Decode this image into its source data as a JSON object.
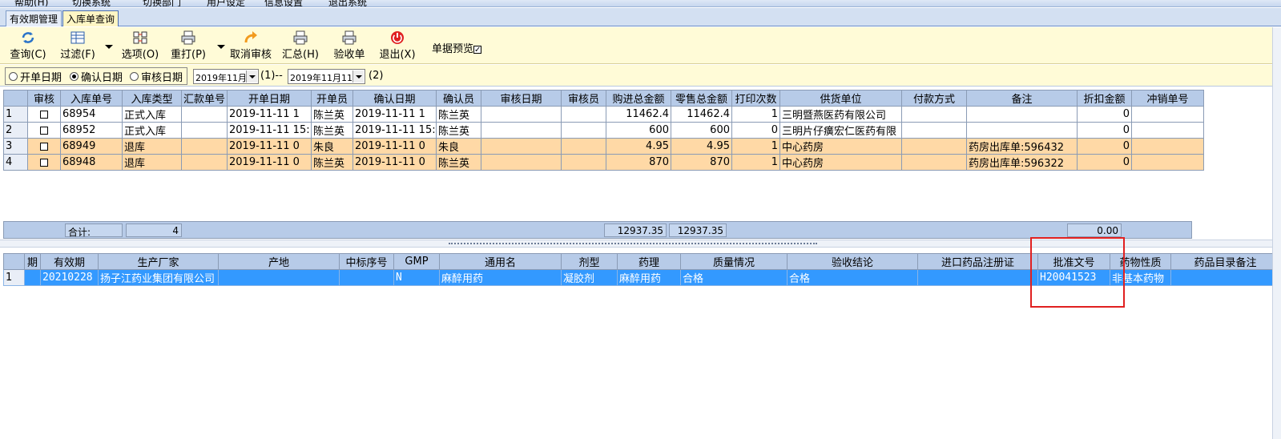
{
  "top_menu": [
    "帮助(H)",
    "切换系统",
    "切换部门",
    "用户设定",
    "信息设置",
    "退出系统"
  ],
  "tabs": [
    {
      "label": "有效期管理",
      "active": false
    },
    {
      "label": "入库单查询",
      "active": true
    }
  ],
  "toolbar": {
    "query": "查询(C)",
    "filter": "过滤(F)",
    "options": "选项(O)",
    "reprint": "重打(P)",
    "cancel_audit": "取消审核",
    "summary": "汇总(H)",
    "inspect": "验收单",
    "exit": "退出(X)",
    "preview_label": "单据预览",
    "preview_checked": true
  },
  "date_filter": {
    "options": [
      "开单日期",
      "确认日期",
      "审核日期"
    ],
    "selected": "确认日期",
    "start": "2019年11月",
    "start_suffix": "(1)--",
    "end": "2019年11月11日",
    "end_suffix": "(2)"
  },
  "upper_grid": {
    "columns": [
      "",
      "审核",
      "入库单号",
      "入库类型",
      "汇款单号",
      "开单日期",
      "开单员",
      "确认日期",
      "确认员",
      "审核日期",
      "审核员",
      "购进总金额",
      "零售总金额",
      "打印次数",
      "供货单位",
      "付款方式",
      "备注",
      "折扣金额",
      "冲销单号"
    ],
    "rows": [
      {
        "idx": "1",
        "no": "68954",
        "type": "正式入库",
        "remit": "",
        "open_date": "2019-11-11 1",
        "opener": "陈兰英",
        "confirm_date": "2019-11-11 1",
        "confirmer": "陈兰英",
        "audit_date": "",
        "auditor": "",
        "purchase": "11462.4",
        "retail": "11462.4",
        "prints": "1",
        "supplier": "三明暨燕医药有限公司",
        "payment": "",
        "note": "",
        "discount": "0",
        "reverse": "",
        "highlight": false
      },
      {
        "idx": "2",
        "no": "68952",
        "type": "正式入库",
        "remit": "",
        "open_date": "2019-11-11 15:",
        "opener": "陈兰英",
        "confirm_date": "2019-11-11 15:",
        "confirmer": "陈兰英",
        "audit_date": "",
        "auditor": "",
        "purchase": "600",
        "retail": "600",
        "prints": "0",
        "supplier": "三明片仔癀宏仁医药有限",
        "payment": "",
        "note": "",
        "discount": "0",
        "reverse": "",
        "highlight": false
      },
      {
        "idx": "3",
        "no": "68949",
        "type": "退库",
        "remit": "",
        "open_date": "2019-11-11 0",
        "opener": "朱良",
        "confirm_date": "2019-11-11 0",
        "confirmer": "朱良",
        "audit_date": "",
        "auditor": "",
        "purchase": "4.95",
        "retail": "4.95",
        "prints": "1",
        "supplier": "中心药房",
        "payment": "",
        "note": "药房出库单:596432",
        "discount": "0",
        "reverse": "",
        "highlight": true
      },
      {
        "idx": "4",
        "no": "68948",
        "type": "退库",
        "remit": "",
        "open_date": "2019-11-11 0",
        "opener": "陈兰英",
        "confirm_date": "2019-11-11 0",
        "confirmer": "陈兰英",
        "audit_date": "",
        "auditor": "",
        "purchase": "870",
        "retail": "870",
        "prints": "1",
        "supplier": "中心药房",
        "payment": "",
        "note": "药房出库单:596322",
        "discount": "0",
        "reverse": "",
        "highlight": true
      }
    ]
  },
  "summary_bar": {
    "label": "合计:",
    "count": "4",
    "purchase_total": "12937.35",
    "retail_total": "12937.35",
    "discount_total": "0.00"
  },
  "lower_grid": {
    "columns": [
      "期",
      "有效期",
      "生产厂家",
      "产地",
      "中标序号",
      "GMP",
      "通用名",
      "剂型",
      "药理",
      "质量情况",
      "验收结论",
      "进口药品注册证",
      "批准文号",
      "药物性质",
      "药品目录备注"
    ],
    "rows": [
      {
        "idx": "1",
        "period": "",
        "expiry": "20210228",
        "maker": "扬子江药业集团有限公司",
        "origin": "",
        "bid_no": "",
        "gmp": "N",
        "generic": "麻醉用药",
        "form": "凝胶剂",
        "pharm": "麻醉用药",
        "quality": "合格",
        "conclusion": "合格",
        "import_cert": "",
        "approval_no": "H20041523",
        "nature": "非基本药物",
        "catalog_note": ""
      }
    ]
  },
  "colors": {
    "header_bg": "#b7cbe8",
    "toolbar_bg": "#fffbd7",
    "highlight_row": "#ffd9a6",
    "selected_row": "#3399ff",
    "annotation_box": "#e02020"
  }
}
